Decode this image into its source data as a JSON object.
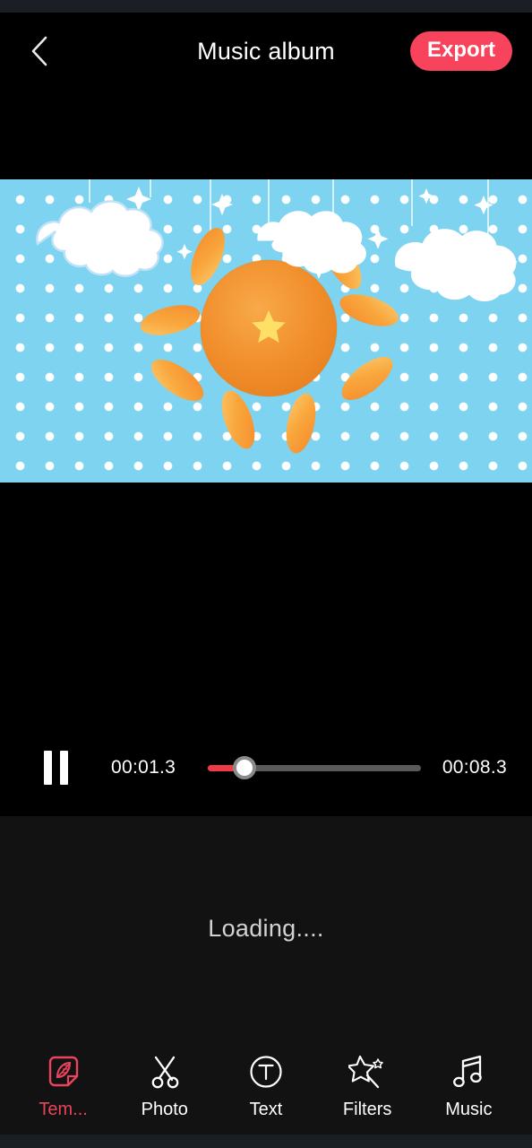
{
  "app": {
    "accent_color": "#f8435c",
    "background_color": "#000000",
    "panel_color": "#121212",
    "status_bar_color": "#1a1f25"
  },
  "header": {
    "back_icon": "chevron-left-icon",
    "title": "Music album",
    "export_label": "Export"
  },
  "preview": {
    "canvas_label": "video-preview-canvas",
    "scene": {
      "description": "Illustrated sun with orange rays, white clouds on polka-dot sky and a flying swallow",
      "sky_color": "#7ed3f0",
      "dot_color": "#ffffff",
      "sun_color": "#f08c2e",
      "ray_color": "#f79a35",
      "cloud_color": "#ffffff",
      "bird_body_color": "#ef7b2f",
      "bird_wing_color": "#2c4a7c",
      "star_color": "#ffe066"
    }
  },
  "transport": {
    "play_state_icon": "pause-icon",
    "current_time": "00:01.3",
    "total_time": "00:08.3",
    "progress_percent": 17,
    "fill_color": "#ef3b46",
    "track_color": "#5a5a5a",
    "thumb_color": "#ffffff"
  },
  "status": {
    "loading_text": "Loading...."
  },
  "toolbar": {
    "items": [
      {
        "label": "Tem...",
        "icon": "template-leaf-icon",
        "active": true
      },
      {
        "label": "Photo",
        "icon": "scissors-icon",
        "active": false
      },
      {
        "label": "Text",
        "icon": "text-circle-icon",
        "active": false
      },
      {
        "label": "Filters",
        "icon": "magic-wand-icon",
        "active": false
      },
      {
        "label": "Music",
        "icon": "music-note-icon",
        "active": false
      }
    ]
  }
}
